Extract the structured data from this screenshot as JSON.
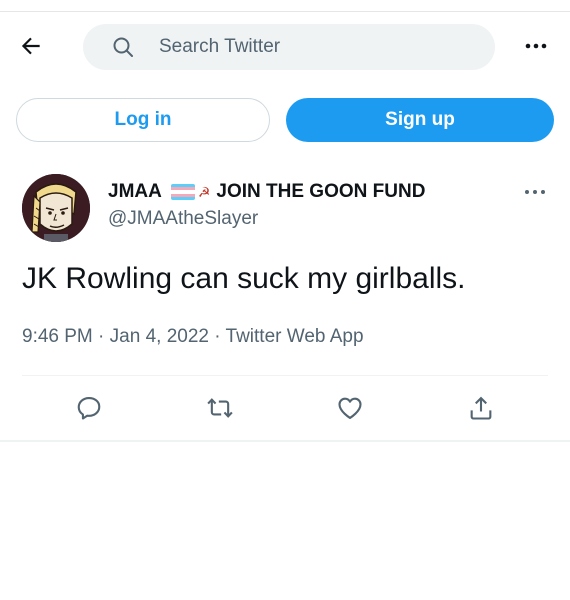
{
  "header": {
    "back_icon": "arrow-left-icon",
    "search": {
      "icon": "search-icon",
      "placeholder": "Search Twitter"
    },
    "more_icon": "more-horizontal-icon"
  },
  "auth": {
    "login_label": "Log in",
    "signup_label": "Sign up"
  },
  "tweet": {
    "author": {
      "name_part1": "JMAA",
      "name_part2": "JOIN THE GOON FUND",
      "emoji": [
        "transgender-flag",
        "hammer-and-sickle"
      ],
      "handle": "@JMAAtheSlayer"
    },
    "text": "JK Rowling can suck my girlballs.",
    "time": "9:46 PM",
    "date": "Jan 4, 2022",
    "source": "Twitter Web App",
    "separator": "·",
    "actions": [
      "reply-icon",
      "retweet-icon",
      "like-icon",
      "share-icon"
    ]
  },
  "colors": {
    "brand": "#1d9bf0",
    "text": "#0f1419",
    "secondary": "#536471",
    "search_bg": "#eff3f4"
  }
}
